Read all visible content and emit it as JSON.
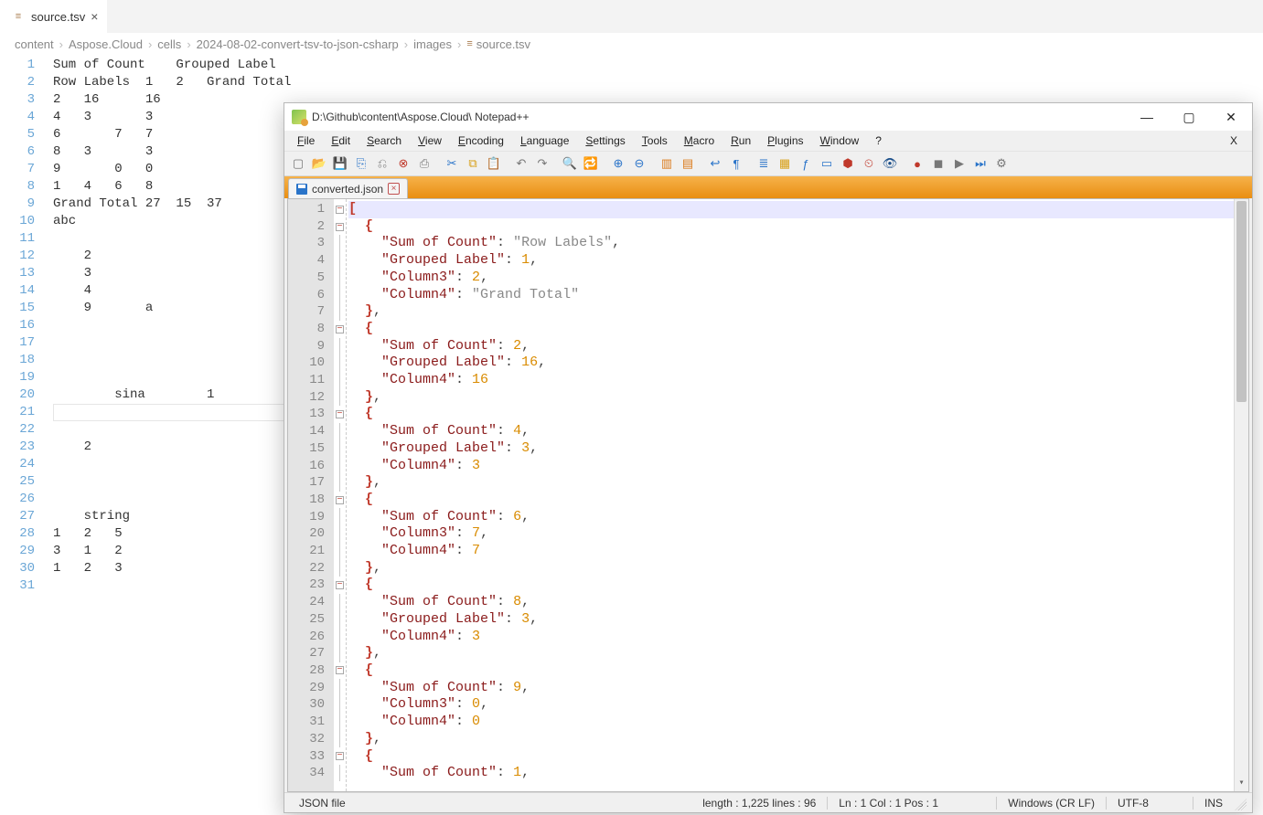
{
  "vscode": {
    "tab": {
      "name": "source.tsv"
    },
    "breadcrumb": [
      "content",
      "Aspose.Cloud",
      "cells",
      "2024-08-02-convert-tsv-to-json-csharp",
      "images",
      "source.tsv"
    ],
    "lines": [
      "Sum of Count    Grouped Label",
      "Row Labels  1   2   Grand Total",
      "2   16      16",
      "4   3       3",
      "6       7   7",
      "8   3       3",
      "9       0   0",
      "1   4   6   8",
      "Grand Total 27  15  37",
      "abc",
      "",
      "    2",
      "    3",
      "    4",
      "    9       a",
      "",
      "",
      "",
      "",
      "        sina        1",
      "",
      "",
      "    2",
      "",
      "",
      "",
      "    string",
      "1   2   5",
      "3   1   2",
      "1   2   3",
      ""
    ],
    "line_count": 31
  },
  "npp": {
    "title": "D:\\Github\\content\\Aspose.Cloud\\ Notepad++",
    "menu": [
      "File",
      "Edit",
      "Search",
      "View",
      "Encoding",
      "Language",
      "Settings",
      "Tools",
      "Macro",
      "Run",
      "Plugins",
      "Window",
      "?"
    ],
    "menu_right": "X",
    "tab": {
      "name": "converted.json"
    },
    "code_lines": [
      {
        "indent": 0,
        "fold": "box",
        "tokens": [
          [
            "br",
            "["
          ]
        ]
      },
      {
        "indent": 1,
        "fold": "box",
        "tokens": [
          [
            "br",
            "{"
          ]
        ]
      },
      {
        "indent": 2,
        "fold": "line",
        "tokens": [
          [
            "key",
            "\"Sum of Count\""
          ],
          [
            "col",
            ": "
          ],
          [
            "str",
            "\"Row Labels\""
          ],
          [
            "punc",
            ","
          ]
        ]
      },
      {
        "indent": 2,
        "fold": "line",
        "tokens": [
          [
            "key",
            "\"Grouped Label\""
          ],
          [
            "col",
            ": "
          ],
          [
            "num",
            "1"
          ],
          [
            "punc",
            ","
          ]
        ]
      },
      {
        "indent": 2,
        "fold": "line",
        "tokens": [
          [
            "key",
            "\"Column3\""
          ],
          [
            "col",
            ": "
          ],
          [
            "num",
            "2"
          ],
          [
            "punc",
            ","
          ]
        ]
      },
      {
        "indent": 2,
        "fold": "line",
        "tokens": [
          [
            "key",
            "\"Column4\""
          ],
          [
            "col",
            ": "
          ],
          [
            "str",
            "\"Grand Total\""
          ]
        ]
      },
      {
        "indent": 1,
        "fold": "line",
        "tokens": [
          [
            "br",
            "}"
          ],
          [
            "punc",
            ","
          ]
        ]
      },
      {
        "indent": 1,
        "fold": "box",
        "tokens": [
          [
            "br",
            "{"
          ]
        ]
      },
      {
        "indent": 2,
        "fold": "line",
        "tokens": [
          [
            "key",
            "\"Sum of Count\""
          ],
          [
            "col",
            ": "
          ],
          [
            "num",
            "2"
          ],
          [
            "punc",
            ","
          ]
        ]
      },
      {
        "indent": 2,
        "fold": "line",
        "tokens": [
          [
            "key",
            "\"Grouped Label\""
          ],
          [
            "col",
            ": "
          ],
          [
            "num",
            "16"
          ],
          [
            "punc",
            ","
          ]
        ]
      },
      {
        "indent": 2,
        "fold": "line",
        "tokens": [
          [
            "key",
            "\"Column4\""
          ],
          [
            "col",
            ": "
          ],
          [
            "num",
            "16"
          ]
        ]
      },
      {
        "indent": 1,
        "fold": "line",
        "tokens": [
          [
            "br",
            "}"
          ],
          [
            "punc",
            ","
          ]
        ]
      },
      {
        "indent": 1,
        "fold": "box",
        "tokens": [
          [
            "br",
            "{"
          ]
        ]
      },
      {
        "indent": 2,
        "fold": "line",
        "tokens": [
          [
            "key",
            "\"Sum of Count\""
          ],
          [
            "col",
            ": "
          ],
          [
            "num",
            "4"
          ],
          [
            "punc",
            ","
          ]
        ]
      },
      {
        "indent": 2,
        "fold": "line",
        "tokens": [
          [
            "key",
            "\"Grouped Label\""
          ],
          [
            "col",
            ": "
          ],
          [
            "num",
            "3"
          ],
          [
            "punc",
            ","
          ]
        ]
      },
      {
        "indent": 2,
        "fold": "line",
        "tokens": [
          [
            "key",
            "\"Column4\""
          ],
          [
            "col",
            ": "
          ],
          [
            "num",
            "3"
          ]
        ]
      },
      {
        "indent": 1,
        "fold": "line",
        "tokens": [
          [
            "br",
            "}"
          ],
          [
            "punc",
            ","
          ]
        ]
      },
      {
        "indent": 1,
        "fold": "box",
        "tokens": [
          [
            "br",
            "{"
          ]
        ]
      },
      {
        "indent": 2,
        "fold": "line",
        "tokens": [
          [
            "key",
            "\"Sum of Count\""
          ],
          [
            "col",
            ": "
          ],
          [
            "num",
            "6"
          ],
          [
            "punc",
            ","
          ]
        ]
      },
      {
        "indent": 2,
        "fold": "line",
        "tokens": [
          [
            "key",
            "\"Column3\""
          ],
          [
            "col",
            ": "
          ],
          [
            "num",
            "7"
          ],
          [
            "punc",
            ","
          ]
        ]
      },
      {
        "indent": 2,
        "fold": "line",
        "tokens": [
          [
            "key",
            "\"Column4\""
          ],
          [
            "col",
            ": "
          ],
          [
            "num",
            "7"
          ]
        ]
      },
      {
        "indent": 1,
        "fold": "line",
        "tokens": [
          [
            "br",
            "}"
          ],
          [
            "punc",
            ","
          ]
        ]
      },
      {
        "indent": 1,
        "fold": "box",
        "tokens": [
          [
            "br",
            "{"
          ]
        ]
      },
      {
        "indent": 2,
        "fold": "line",
        "tokens": [
          [
            "key",
            "\"Sum of Count\""
          ],
          [
            "col",
            ": "
          ],
          [
            "num",
            "8"
          ],
          [
            "punc",
            ","
          ]
        ]
      },
      {
        "indent": 2,
        "fold": "line",
        "tokens": [
          [
            "key",
            "\"Grouped Label\""
          ],
          [
            "col",
            ": "
          ],
          [
            "num",
            "3"
          ],
          [
            "punc",
            ","
          ]
        ]
      },
      {
        "indent": 2,
        "fold": "line",
        "tokens": [
          [
            "key",
            "\"Column4\""
          ],
          [
            "col",
            ": "
          ],
          [
            "num",
            "3"
          ]
        ]
      },
      {
        "indent": 1,
        "fold": "line",
        "tokens": [
          [
            "br",
            "}"
          ],
          [
            "punc",
            ","
          ]
        ]
      },
      {
        "indent": 1,
        "fold": "box",
        "tokens": [
          [
            "br",
            "{"
          ]
        ]
      },
      {
        "indent": 2,
        "fold": "line",
        "tokens": [
          [
            "key",
            "\"Sum of Count\""
          ],
          [
            "col",
            ": "
          ],
          [
            "num",
            "9"
          ],
          [
            "punc",
            ","
          ]
        ]
      },
      {
        "indent": 2,
        "fold": "line",
        "tokens": [
          [
            "key",
            "\"Column3\""
          ],
          [
            "col",
            ": "
          ],
          [
            "num",
            "0"
          ],
          [
            "punc",
            ","
          ]
        ]
      },
      {
        "indent": 2,
        "fold": "line",
        "tokens": [
          [
            "key",
            "\"Column4\""
          ],
          [
            "col",
            ": "
          ],
          [
            "num",
            "0"
          ]
        ]
      },
      {
        "indent": 1,
        "fold": "line",
        "tokens": [
          [
            "br",
            "}"
          ],
          [
            "punc",
            ","
          ]
        ]
      },
      {
        "indent": 1,
        "fold": "box",
        "tokens": [
          [
            "br",
            "{"
          ]
        ]
      },
      {
        "indent": 2,
        "fold": "line",
        "tokens": [
          [
            "key",
            "\"Sum of Count\""
          ],
          [
            "col",
            ": "
          ],
          [
            "num",
            "1"
          ],
          [
            "punc",
            ","
          ]
        ]
      }
    ],
    "status": {
      "type": "JSON file",
      "length": "length : 1,225   lines : 96",
      "pos": "Ln : 1   Col : 1   Pos : 1",
      "eol": "Windows (CR LF)",
      "encoding": "UTF-8",
      "mode": "INS"
    }
  }
}
